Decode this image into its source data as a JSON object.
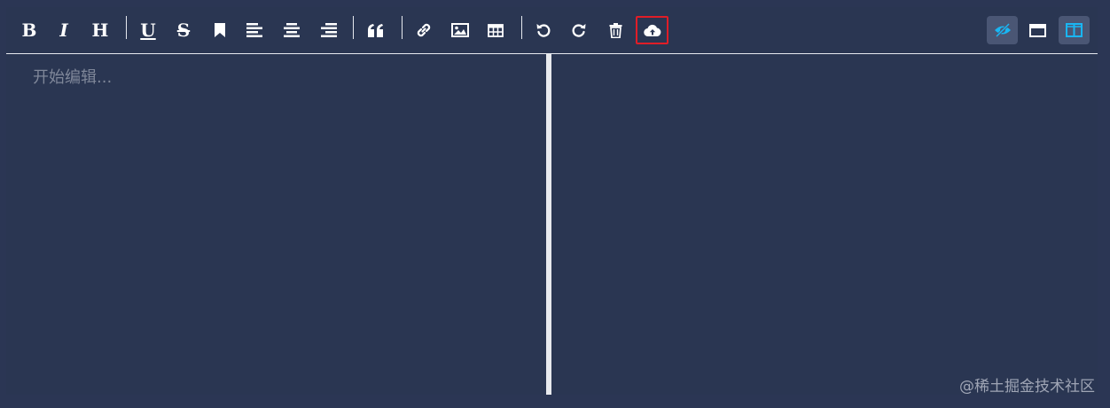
{
  "toolbar": {
    "bold": "B",
    "italic": "I",
    "heading": "H",
    "underline": "U",
    "strikethrough": "S"
  },
  "editor": {
    "placeholder": "开始编辑..."
  },
  "watermark": "@稀土掘金技术社区",
  "colors": {
    "background": "#2a3652",
    "highlight_border": "#e01d27",
    "active_icon": "#19b6f3"
  },
  "icons": [
    "bold",
    "italic",
    "heading",
    "underline",
    "strikethrough",
    "bookmark",
    "align-left",
    "align-center",
    "align-right",
    "quote",
    "link",
    "image",
    "table",
    "undo",
    "redo",
    "trash",
    "cloud-upload",
    "preview",
    "fullscreen",
    "split-view"
  ]
}
